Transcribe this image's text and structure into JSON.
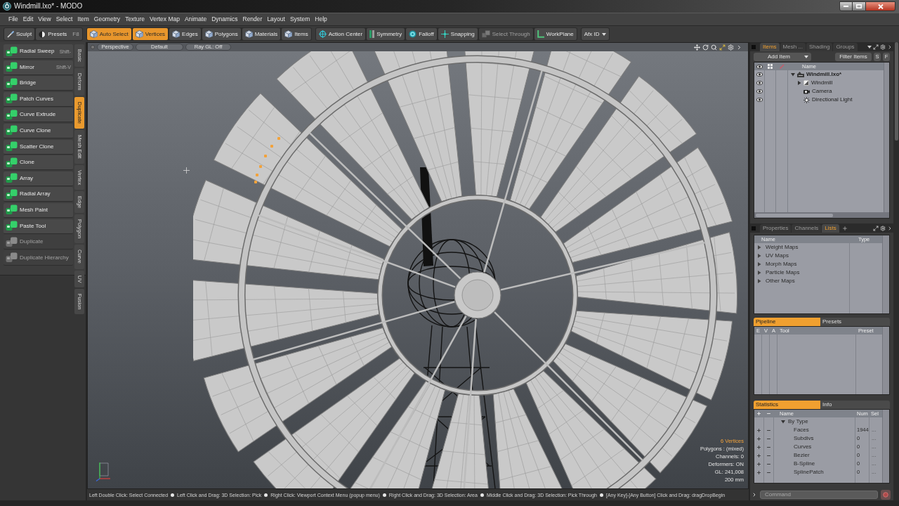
{
  "window": {
    "title": "Windmill.lxo* - MODO"
  },
  "menu": [
    "File",
    "Edit",
    "View",
    "Select",
    "Item",
    "Geometry",
    "Texture",
    "Vertex Map",
    "Animate",
    "Dynamics",
    "Render",
    "Layout",
    "System",
    "Help"
  ],
  "toolbar": [
    {
      "buttons": [
        {
          "label": "Sculpt",
          "kind": "button",
          "selected": false,
          "disabled": false
        },
        {
          "label": "Presets",
          "shortcut": "F8",
          "kind": "button",
          "selected": false,
          "disabled": false
        }
      ]
    },
    {
      "buttons": [
        {
          "label": "Auto Select",
          "kind": "button",
          "selected": true,
          "disabled": false
        },
        {
          "label": "Vertices",
          "kind": "button",
          "selected": true,
          "disabled": false
        },
        {
          "label": "Edges",
          "kind": "button",
          "selected": false,
          "disabled": false
        },
        {
          "label": "Polygons",
          "kind": "button",
          "selected": false,
          "disabled": false
        },
        {
          "label": "Materials",
          "kind": "button",
          "selected": false,
          "disabled": false
        },
        {
          "label": "Items",
          "kind": "button",
          "selected": false,
          "disabled": false
        }
      ]
    },
    {
      "buttons": [
        {
          "label": "Action Center",
          "kind": "button",
          "selected": false,
          "disabled": false
        },
        {
          "label": "Symmetry",
          "kind": "button",
          "selected": false,
          "disabled": false
        },
        {
          "label": "Falloff",
          "kind": "button",
          "selected": false,
          "disabled": false
        },
        {
          "label": "Snapping",
          "kind": "button",
          "selected": false,
          "disabled": false
        },
        {
          "label": "Select Through",
          "kind": "button",
          "selected": false,
          "disabled": true
        },
        {
          "label": "WorkPlane",
          "kind": "button",
          "selected": false,
          "disabled": false
        }
      ]
    },
    {
      "buttons": [
        {
          "label": "Afx ID",
          "kind": "dropdown",
          "selected": false,
          "disabled": false
        }
      ]
    }
  ],
  "tools": [
    {
      "label": "Radial Sweep",
      "shortcut": "Shift-",
      "disabled": false
    },
    {
      "label": "Mirror",
      "shortcut": "Shift-V",
      "disabled": false
    },
    {
      "label": "Bridge",
      "disabled": false
    },
    {
      "label": "Patch Curves",
      "disabled": false
    },
    {
      "label": "Curve Extrude",
      "disabled": false
    },
    {
      "label": "Curve Clone",
      "disabled": false
    },
    {
      "label": "Scatter Clone",
      "disabled": false
    },
    {
      "label": "Clone",
      "disabled": false
    },
    {
      "label": "Array",
      "disabled": false
    },
    {
      "label": "Radial Array",
      "disabled": false
    },
    {
      "label": "Mesh Paint",
      "disabled": false
    },
    {
      "label": "Paste Tool",
      "disabled": false
    },
    {
      "label": "Duplicate",
      "disabled": true
    },
    {
      "label": "Duplicate Hierarchy",
      "disabled": true
    }
  ],
  "tool_tabs": [
    {
      "label": "Basic",
      "selected": false
    },
    {
      "label": "Deform",
      "selected": false
    },
    {
      "label": "Duplicate",
      "selected": true
    },
    {
      "label": "Mesh Edit",
      "selected": false
    },
    {
      "label": "Vertex",
      "selected": false
    },
    {
      "label": "Edge",
      "selected": false
    },
    {
      "label": "Polygon",
      "selected": false
    },
    {
      "label": "Curve",
      "selected": false
    },
    {
      "label": "UV",
      "selected": false
    },
    {
      "label": "Fusion",
      "selected": false
    }
  ],
  "viewport": {
    "view_buttons": [
      "Perspective",
      "Default",
      "Ray GL: Off"
    ],
    "info": [
      {
        "text": "6 Vertices",
        "highlighted": true
      },
      {
        "text": "Polygons : (mixed)",
        "highlighted": false
      },
      {
        "text": "Channels: 0",
        "highlighted": false
      },
      {
        "text": "Deformers: ON",
        "highlighted": false
      },
      {
        "text": "GL: 241,008",
        "highlighted": false
      },
      {
        "text": "200 mm",
        "highlighted": false
      }
    ]
  },
  "status_hints": [
    "Left Double Click: Select Connected",
    "Left Click and Drag: 3D Selection: Pick",
    "Right Click: Viewport Context Menu (popup menu)",
    "Right Click and Drag: 3D Selection: Area",
    "Middle Click and Drag: 3D Selection: Pick Through",
    "[Any Key]-[Any Button] Click and Drag: dragDropBegin"
  ],
  "items_panel": {
    "tabs": [
      {
        "label": "Items",
        "selected": true
      },
      {
        "label": "Mesh ...",
        "selected": false
      },
      {
        "label": "Shading",
        "selected": false
      },
      {
        "label": "Groups",
        "selected": false
      }
    ],
    "add_button": "Add Item",
    "filter_button": "Filter Items",
    "toggles": [
      "S",
      "F"
    ],
    "name_column": "Name",
    "tree": [
      {
        "name": "Windmill.lxo*",
        "kind": "scene",
        "expanded": true,
        "children": [
          {
            "name": "Windmill",
            "kind": "mesh",
            "expanded": false
          },
          {
            "name": "Camera",
            "kind": "camera"
          },
          {
            "name": "Directional Light",
            "kind": "light"
          }
        ]
      }
    ]
  },
  "lists_panel": {
    "tabs": [
      {
        "label": "Properties",
        "selected": false
      },
      {
        "label": "Channels",
        "selected": false
      },
      {
        "label": "Lists",
        "selected": true
      }
    ],
    "columns": [
      "Name",
      "Type"
    ],
    "rows": [
      {
        "name": "Weight Maps",
        "expanded": false
      },
      {
        "name": "UV Maps",
        "expanded": false
      },
      {
        "name": "Morph Maps",
        "expanded": false
      },
      {
        "name": "Particle Maps",
        "expanded": false
      },
      {
        "name": "Other Maps",
        "expanded": false
      }
    ]
  },
  "pipeline_panel": {
    "tabs": [
      {
        "label": "Pipeline",
        "selected": true
      },
      {
        "label": "Presets",
        "selected": false
      }
    ],
    "columns": [
      "E",
      "V",
      "A",
      "Tool",
      "Preset"
    ]
  },
  "statistics_panel": {
    "tabs": [
      {
        "label": "Statistics",
        "selected": true
      },
      {
        "label": "Info",
        "selected": false
      }
    ],
    "columns": [
      "Name",
      "Num",
      "Sel"
    ],
    "rows": [
      {
        "name": "By Type",
        "expanded": true,
        "children": [
          {
            "name": "Faces",
            "num": "1944",
            "sel": "..."
          },
          {
            "name": "Subdivs",
            "num": "0",
            "sel": "..."
          },
          {
            "name": "Curves",
            "num": "0",
            "sel": "..."
          },
          {
            "name": "Bezier",
            "num": "0",
            "sel": "..."
          },
          {
            "name": "B-Spline",
            "num": "0",
            "sel": "..."
          },
          {
            "name": "SplinePatch",
            "num": "0",
            "sel": "..."
          }
        ]
      }
    ]
  },
  "command": {
    "placeholder": "Command"
  }
}
